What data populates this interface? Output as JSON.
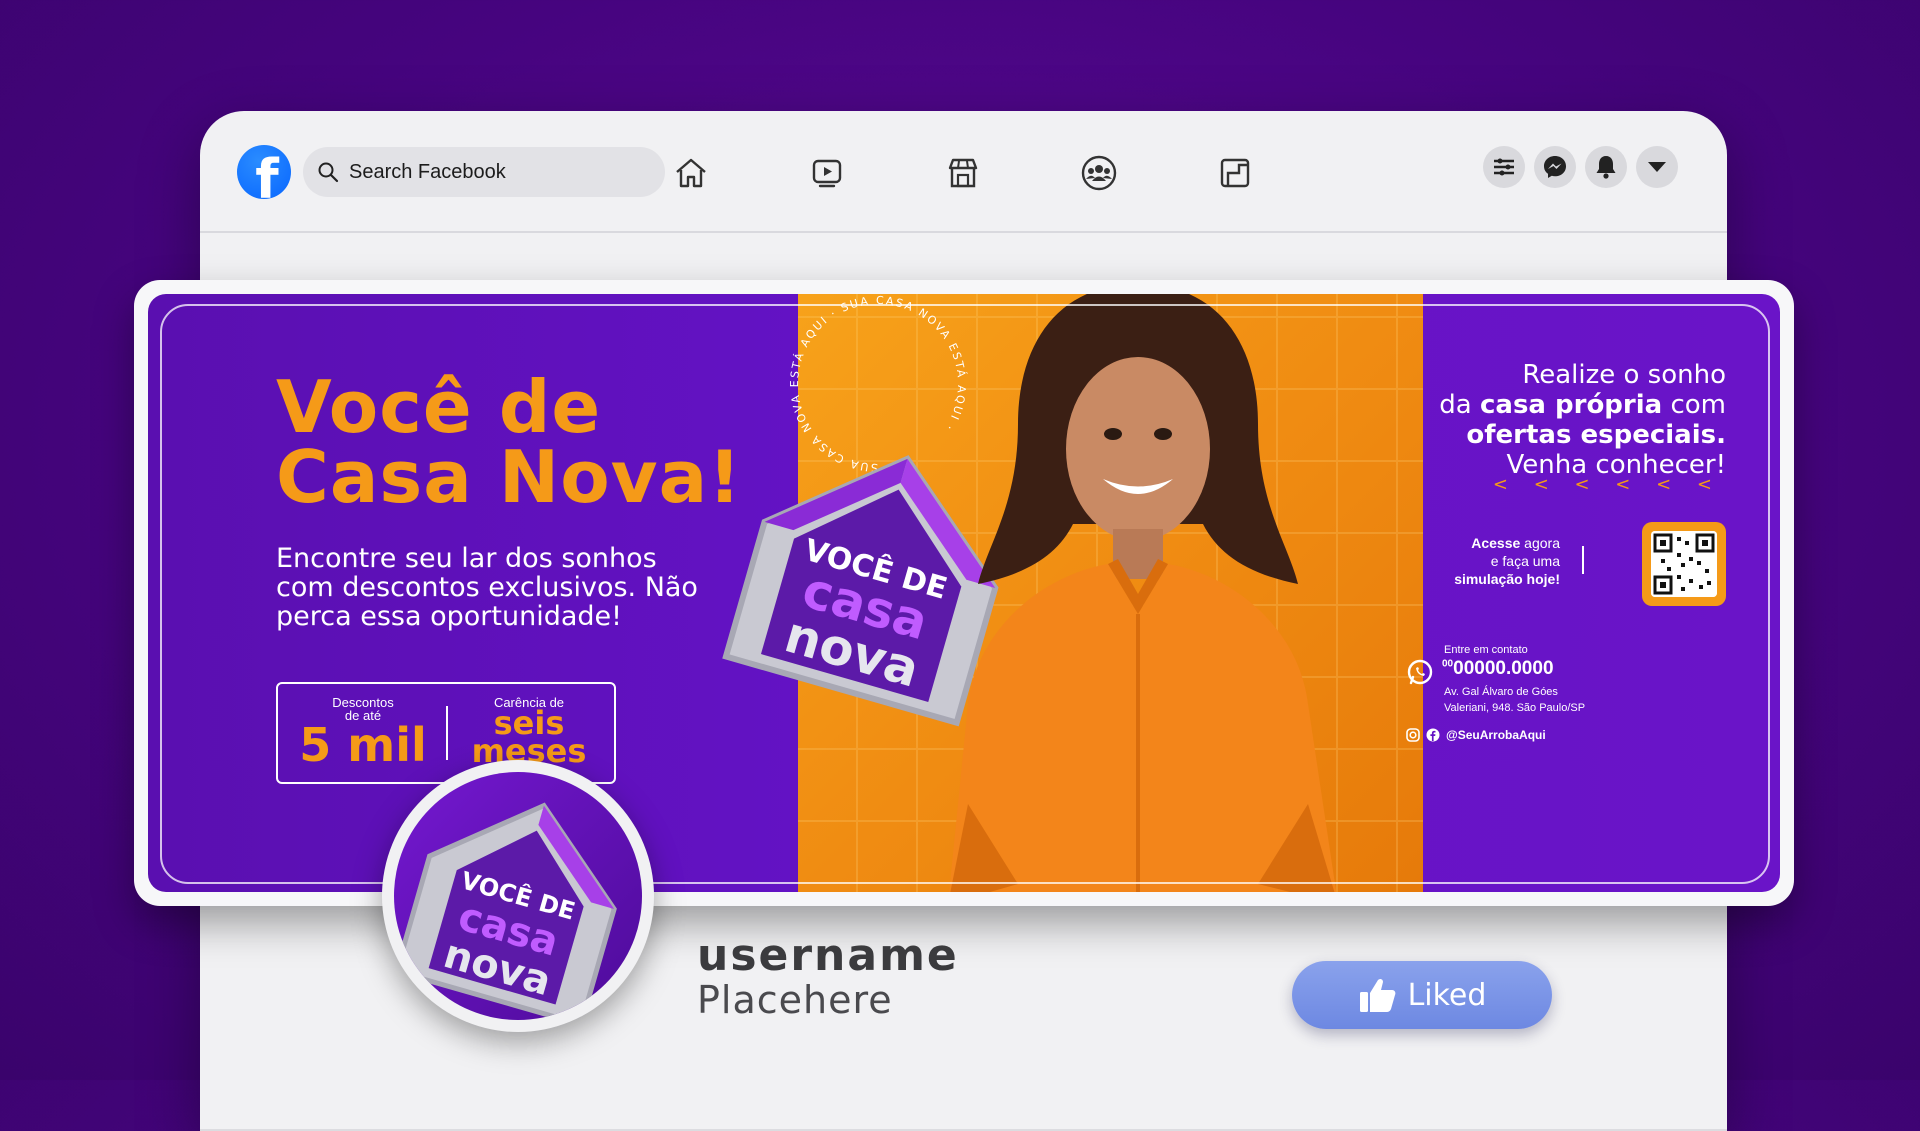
{
  "topbar": {
    "logo_icon": "facebook-logo",
    "search_placeholder": "Search Facebook",
    "nav_icons": [
      "home-icon",
      "video-icon",
      "marketplace-icon",
      "groups-icon",
      "gaming-icon"
    ],
    "right_icons": [
      "menu-icon",
      "messenger-icon",
      "notifications-icon",
      "account-dropdown-icon"
    ]
  },
  "cover": {
    "headline_line1": "Você de",
    "headline_line2": "Casa Nova!",
    "subtext": "Encontre seu lar dos sonhos com descontos exclusivos. Não perca essa oportunidade!",
    "offer1_small_line1": "Descontos",
    "offer1_small_line2": "de até",
    "offer1_big": "5 mil",
    "offer2_small": "Carência de",
    "offer2_big_line1": "seis",
    "offer2_big_line2": "meses",
    "badge_line1": "VOCÊ DE",
    "badge_line2": "casa",
    "badge_line3": "nova",
    "ring_text": "SUA CASA NOVA ESTÁ AQUI · SUA CASA NOVA ESTÁ AQUI ·",
    "right_line1": "Realize o sonho",
    "right_line2a": "da ",
    "right_line2b": "casa própria",
    "right_line2c": " com",
    "right_line3": "ofertas especiais.",
    "right_line4": "Venha conhecer!",
    "chevrons": "< < < < < <",
    "cta_line1a": "Acesse",
    "cta_line1b": " agora",
    "cta_line2": "e faça uma",
    "cta_line3": "simulação hoje!",
    "contact_label": "Entre em contato",
    "phone_prefix": "00",
    "phone": "00000.0000",
    "address_line1": "Av. Gal Álvaro de Góes",
    "address_line2": "Valeriani, 948. São Paulo/SP",
    "social_handle": "@SeuArrobaAqui"
  },
  "profile": {
    "username": "username",
    "placeholder": "Placehere",
    "liked_label": "Liked"
  },
  "colors": {
    "background": "#46047f",
    "banner_purple": "#6312c4",
    "accent_orange": "#f59a18",
    "liked_blue": "#7a93e6"
  }
}
